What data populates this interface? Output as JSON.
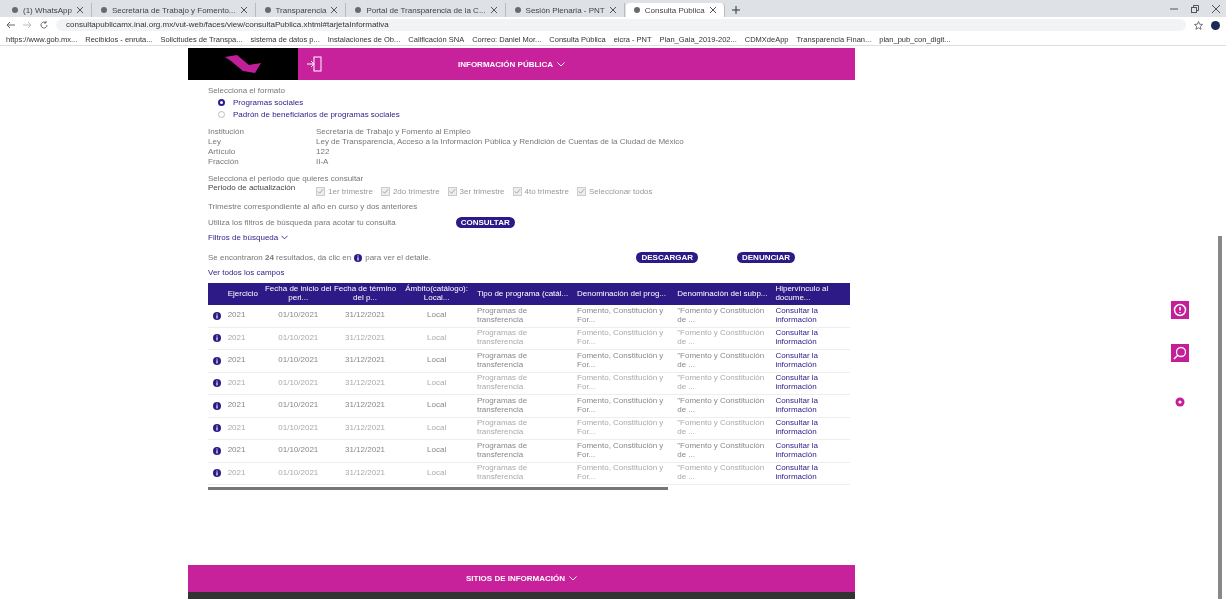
{
  "browser": {
    "tabs": [
      {
        "title": "(1) WhatsApp",
        "selected": false
      },
      {
        "title": "Secretaría de Trabajo y Fomento...",
        "selected": false
      },
      {
        "title": "Transparencia",
        "selected": false
      },
      {
        "title": "Portal de Transparencia de la C...",
        "selected": false
      },
      {
        "title": "Sesión Plenaria - PNT",
        "selected": false
      },
      {
        "title": "Consulta Pública",
        "selected": true
      }
    ],
    "address": "consultapublicamx.inai.org.mx/vut-web/faces/view/consultaPublica.xhtml#tarjetaInformativa",
    "bookmarks": [
      "https://www.gob.mx...",
      "Recibidos - enruta...",
      "Solicitudes de Transpa...",
      "sistema de datos p...",
      "Instalaciones de Ob...",
      "Calificación SNA",
      "Correo: Daniel Mor...",
      "Consulta Pública",
      "eicra - PNT",
      "Plan_Gaia_2019-202...",
      "CDMXdeApp",
      "Transparencia Finan...",
      "plan_pub_con_digit..."
    ]
  },
  "header": {
    "title": "INFORMACIÓN PÚBLICA"
  },
  "format": {
    "label": "Selecciona el formato",
    "options": [
      {
        "label": "Programas sociales",
        "selected": true
      },
      {
        "label": "Padrón de beneficiarios de programas sociales",
        "selected": false
      }
    ]
  },
  "details": [
    {
      "label": "Institución",
      "value": "Secretaría de Trabajo y Fomento al Empleo"
    },
    {
      "label": "Ley",
      "value": "Ley de Transparencia, Acceso a la Información Pública y Rendición de Cuentas de la Ciudad de México"
    },
    {
      "label": "Artículo",
      "value": "122"
    },
    {
      "label": "Fracción",
      "value": "II-A"
    }
  ],
  "period": {
    "prompt": "Selecciona el periodo que quieres consultar",
    "label": "Periodo de actualización",
    "options": [
      {
        "label": "1er trimestre",
        "checked": true
      },
      {
        "label": "2do trimestre",
        "checked": true
      },
      {
        "label": "3er trimestre",
        "checked": true
      },
      {
        "label": "4to trimestre",
        "checked": true
      },
      {
        "label": "Seleccionar todos",
        "checked": true
      }
    ],
    "note": "Trimestre correspondiente al año en curso y dos anteriores"
  },
  "filters": {
    "hint": "Utiliza los filtros de búsqueda para acotar tu consulta",
    "consult_button": "CONSULTAR",
    "toggle": "Filtros de búsqueda"
  },
  "results": {
    "text_before": "Se encontraron **24** resultados, da clic en",
    "text_after": "para ver el detalle.",
    "download_button": "DESCARGAR",
    "report_button": "DENUNCIAR",
    "all_fields_link": "Ver todos los campos"
  },
  "table": {
    "columns": [
      "Ejercicio",
      "Fecha de inicio del peri...",
      "Fecha de término del p...",
      "Ámbito(catálogo): Local...",
      "Tipo de programa (catál...",
      "Denominación del prog...",
      "Denominación del subp...",
      "Hipervínculo al docume..."
    ],
    "rows": [
      [
        "2021",
        "01/10/2021",
        "31/12/2021",
        "Local",
        "Programas de transferencia",
        "Fomento, Constitución y For...",
        "\"Fomento y Constitución de ...",
        "Consultar la información"
      ],
      [
        "2021",
        "01/10/2021",
        "31/12/2021",
        "Local",
        "Programas de transferencia",
        "Fomento, Constitución y For...",
        "\"Fomento y Constitución de ...",
        "Consultar la información"
      ],
      [
        "2021",
        "01/10/2021",
        "31/12/2021",
        "Local",
        "Programas de transferencia",
        "Fomento, Constitución y For...",
        "\"Fomento y Constitución de ...",
        "Consultar la información"
      ],
      [
        "2021",
        "01/10/2021",
        "31/12/2021",
        "Local",
        "Programas de transferencia",
        "Fomento, Constitución y For...",
        "\"Fomento y Constitución de ...",
        "Consultar la información"
      ],
      [
        "2021",
        "01/10/2021",
        "31/12/2021",
        "Local",
        "Programas de transferencia",
        "Fomento, Constitución y For...",
        "\"Fomento y Constitución de ...",
        "Consultar la información"
      ],
      [
        "2021",
        "01/10/2021",
        "31/12/2021",
        "Local",
        "Programas de transferencia",
        "Fomento, Constitución y For...",
        "\"Fomento y Constitución de ...",
        "Consultar la información"
      ],
      [
        "2021",
        "01/10/2021",
        "31/12/2021",
        "Local",
        "Programas de transferencia",
        "Fomento, Constitución y For...",
        "\"Fomento y Constitución de ...",
        "Consultar la información"
      ],
      [
        "2021",
        "01/10/2021",
        "31/12/2021",
        "Local",
        "Programas de transferencia",
        "Fomento, Constitución y For...",
        "\"Fomento y Constitución de ...",
        "Consultar la información"
      ]
    ]
  },
  "footer": {
    "title": "SITIOS DE INFORMACIÓN"
  }
}
